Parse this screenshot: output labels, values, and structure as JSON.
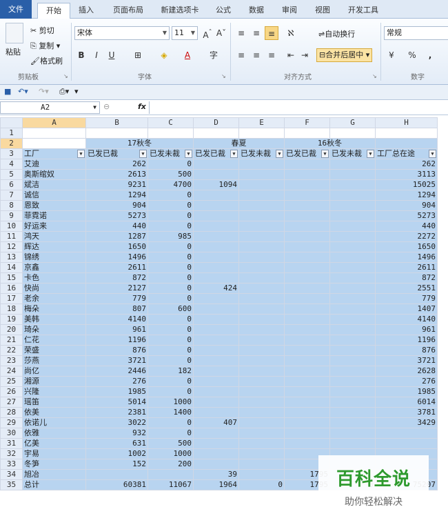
{
  "ribbon_tabs": [
    "文件",
    "开始",
    "插入",
    "页面布局",
    "新建选项卡",
    "公式",
    "数据",
    "审阅",
    "视图",
    "开发工具"
  ],
  "clipboard": {
    "paste": "粘贴",
    "cut": "剪切",
    "copy": "复制",
    "format_painter": "格式刷",
    "label": "剪贴板"
  },
  "font": {
    "name": "宋体",
    "size": "11",
    "label": "字体",
    "bold": "B",
    "italic": "I",
    "underline": "U"
  },
  "alignment": {
    "wrap": "自动换行",
    "merge": "合并后居中",
    "label": "对齐方式"
  },
  "number": {
    "format": "常规",
    "percent": "%",
    "comma": ",",
    "label": "数字"
  },
  "formula_bar": {
    "name_box": "A2",
    "fx": "fx",
    "value": ""
  },
  "columns": [
    "A",
    "B",
    "C",
    "D",
    "E",
    "F",
    "G",
    "H"
  ],
  "header_row2": {
    "g1": "17秋冬",
    "g2": "春夏",
    "g3": "16秋冬"
  },
  "header_row3": [
    "工厂",
    "已发已裁",
    "已发未裁",
    "已发已裁",
    "已发未裁",
    "已发已裁",
    "已发未裁",
    "工厂总在途"
  ],
  "rows": [
    {
      "num": "4",
      "cells": [
        "艾迪",
        "262",
        "0",
        "",
        "",
        "",
        "",
        "262"
      ]
    },
    {
      "num": "5",
      "cells": [
        "奥斯绾奴",
        "2613",
        "500",
        "",
        "",
        "",
        "",
        "3113"
      ]
    },
    {
      "num": "6",
      "cells": [
        "斌洁",
        "9231",
        "4700",
        "1094",
        "",
        "",
        "",
        "15025"
      ]
    },
    {
      "num": "7",
      "cells": [
        "诚信",
        "1294",
        "0",
        "",
        "",
        "",
        "",
        "1294"
      ]
    },
    {
      "num": "8",
      "cells": [
        "恩致",
        "904",
        "0",
        "",
        "",
        "",
        "",
        "904"
      ]
    },
    {
      "num": "9",
      "cells": [
        "菲霓诺",
        "5273",
        "0",
        "",
        "",
        "",
        "",
        "5273"
      ]
    },
    {
      "num": "10",
      "cells": [
        "好运来",
        "440",
        "0",
        "",
        "",
        "",
        "",
        "440"
      ]
    },
    {
      "num": "11",
      "cells": [
        "鸿天",
        "1287",
        "985",
        "",
        "",
        "",
        "",
        "2272"
      ]
    },
    {
      "num": "12",
      "cells": [
        "辉达",
        "1650",
        "0",
        "",
        "",
        "",
        "",
        "1650"
      ]
    },
    {
      "num": "13",
      "cells": [
        "锦绣",
        "1496",
        "0",
        "",
        "",
        "",
        "",
        "1496"
      ]
    },
    {
      "num": "14",
      "cells": [
        "京鑫",
        "2611",
        "0",
        "",
        "",
        "",
        "",
        "2611"
      ]
    },
    {
      "num": "15",
      "cells": [
        "卡色",
        "872",
        "0",
        "",
        "",
        "",
        "",
        "872"
      ]
    },
    {
      "num": "16",
      "cells": [
        "快尚",
        "2127",
        "0",
        "424",
        "",
        "",
        "",
        "2551"
      ]
    },
    {
      "num": "17",
      "cells": [
        "老余",
        "779",
        "0",
        "",
        "",
        "",
        "",
        "779"
      ]
    },
    {
      "num": "18",
      "cells": [
        "梅朵",
        "807",
        "600",
        "",
        "",
        "",
        "",
        "1407"
      ]
    },
    {
      "num": "19",
      "cells": [
        "美韩",
        "4140",
        "0",
        "",
        "",
        "",
        "",
        "4140"
      ]
    },
    {
      "num": "20",
      "cells": [
        "琦朵",
        "961",
        "0",
        "",
        "",
        "",
        "",
        "961"
      ]
    },
    {
      "num": "21",
      "cells": [
        "仁花",
        "1196",
        "0",
        "",
        "",
        "",
        "",
        "1196"
      ]
    },
    {
      "num": "22",
      "cells": [
        "荣盛",
        "876",
        "0",
        "",
        "",
        "",
        "",
        "876"
      ]
    },
    {
      "num": "23",
      "cells": [
        "莎燕",
        "3721",
        "0",
        "",
        "",
        "",
        "",
        "3721"
      ]
    },
    {
      "num": "24",
      "cells": [
        "尚亿",
        "2446",
        "182",
        "",
        "",
        "",
        "",
        "2628"
      ]
    },
    {
      "num": "25",
      "cells": [
        "湘源",
        "276",
        "0",
        "",
        "",
        "",
        "",
        "276"
      ]
    },
    {
      "num": "26",
      "cells": [
        "兴隆",
        "1985",
        "0",
        "",
        "",
        "",
        "",
        "1985"
      ]
    },
    {
      "num": "27",
      "cells": [
        "瑶笛",
        "5014",
        "1000",
        "",
        "",
        "",
        "",
        "6014"
      ]
    },
    {
      "num": "28",
      "cells": [
        "依美",
        "2381",
        "1400",
        "",
        "",
        "",
        "",
        "3781"
      ]
    },
    {
      "num": "29",
      "cells": [
        "依诺儿",
        "3022",
        "0",
        "407",
        "",
        "",
        "",
        "3429"
      ]
    },
    {
      "num": "30",
      "cells": [
        "依雅",
        "932",
        "0",
        "",
        "",
        "",
        "",
        ""
      ]
    },
    {
      "num": "31",
      "cells": [
        "亿美",
        "631",
        "500",
        "",
        "",
        "",
        "",
        ""
      ]
    },
    {
      "num": "32",
      "cells": [
        "宇易",
        "1002",
        "1000",
        "",
        "",
        "",
        "",
        ""
      ]
    },
    {
      "num": "33",
      "cells": [
        "冬笋",
        "152",
        "200",
        "",
        "",
        "",
        "",
        ""
      ]
    },
    {
      "num": "34",
      "cells": [
        "旭冶",
        "",
        "",
        "39",
        "",
        "1795",
        "",
        ""
      ]
    },
    {
      "num": "35",
      "cells": [
        "总计",
        "60381",
        "11067",
        "1964",
        "0",
        "1795",
        "0",
        "75207"
      ]
    }
  ],
  "watermark": {
    "main": "百科全说",
    "sub": "助你轻松解决"
  }
}
